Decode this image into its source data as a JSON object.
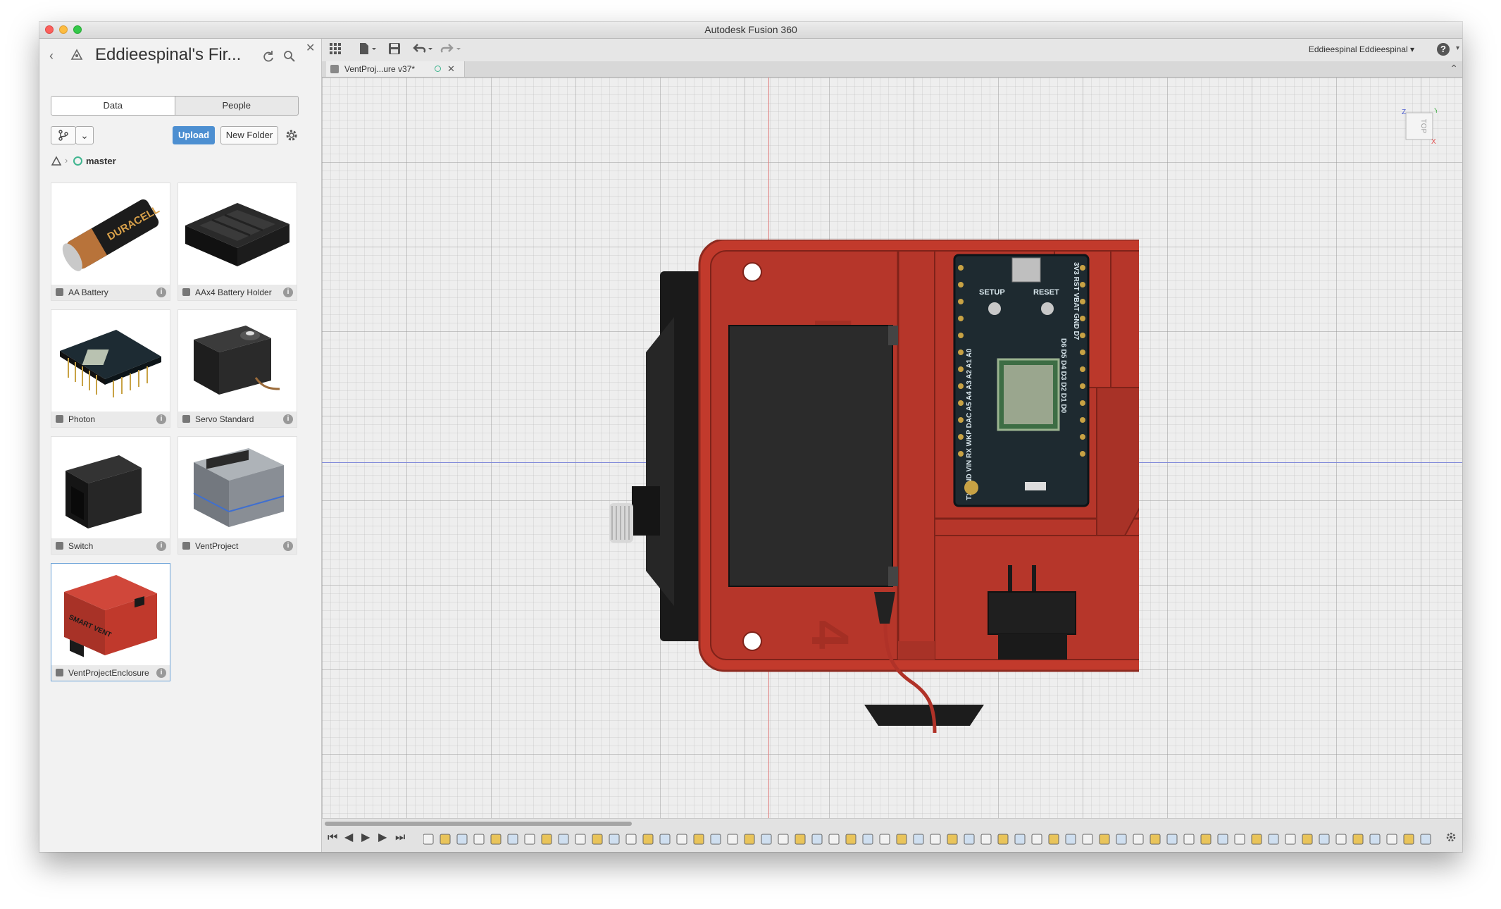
{
  "window": {
    "title": "Autodesk Fusion 360"
  },
  "data_panel": {
    "project_title": "Eddieespinal's Fir...",
    "tabs": [
      {
        "label": "Data",
        "active": true
      },
      {
        "label": "People",
        "active": false
      }
    ],
    "upload_label": "Upload",
    "new_folder_label": "New Folder",
    "breadcrumb_branch": "master",
    "items": [
      {
        "name": "AA Battery",
        "thumb_text": "DURACELL"
      },
      {
        "name": "AAx4 Battery Holder"
      },
      {
        "name": "Photon"
      },
      {
        "name": "Servo Standard"
      },
      {
        "name": "Switch"
      },
      {
        "name": "VentProject"
      },
      {
        "name": "VentProjectEnclosure",
        "selected": true,
        "thumb_text": "SMART VENT"
      }
    ]
  },
  "toolbar": {
    "user_label": "Eddieespinal Eddieespinal ▾",
    "help_label": "?"
  },
  "document_tab": {
    "label": "VentProj...ure v37*"
  },
  "viewcube": {
    "face_label": "TOP",
    "axis_z": "Z",
    "axis_x": "X",
    "axis_y": "Y"
  },
  "board_labels": {
    "setup": "SETUP",
    "reset": "RESET",
    "top_pins": "3V3 RST VBAT GND D7",
    "right_pins": "D6 D5 D4 D3 D2 D1 D0",
    "left_pins": "TX GND VIN RX WKP DAC A5 A4 A3 A2 A1 A0"
  },
  "colors": {
    "enclosure": "#c23a2c",
    "enclosure_dark": "#a02d22",
    "servo": "#2e2e2e",
    "accent_blue": "#4d8fd1"
  }
}
